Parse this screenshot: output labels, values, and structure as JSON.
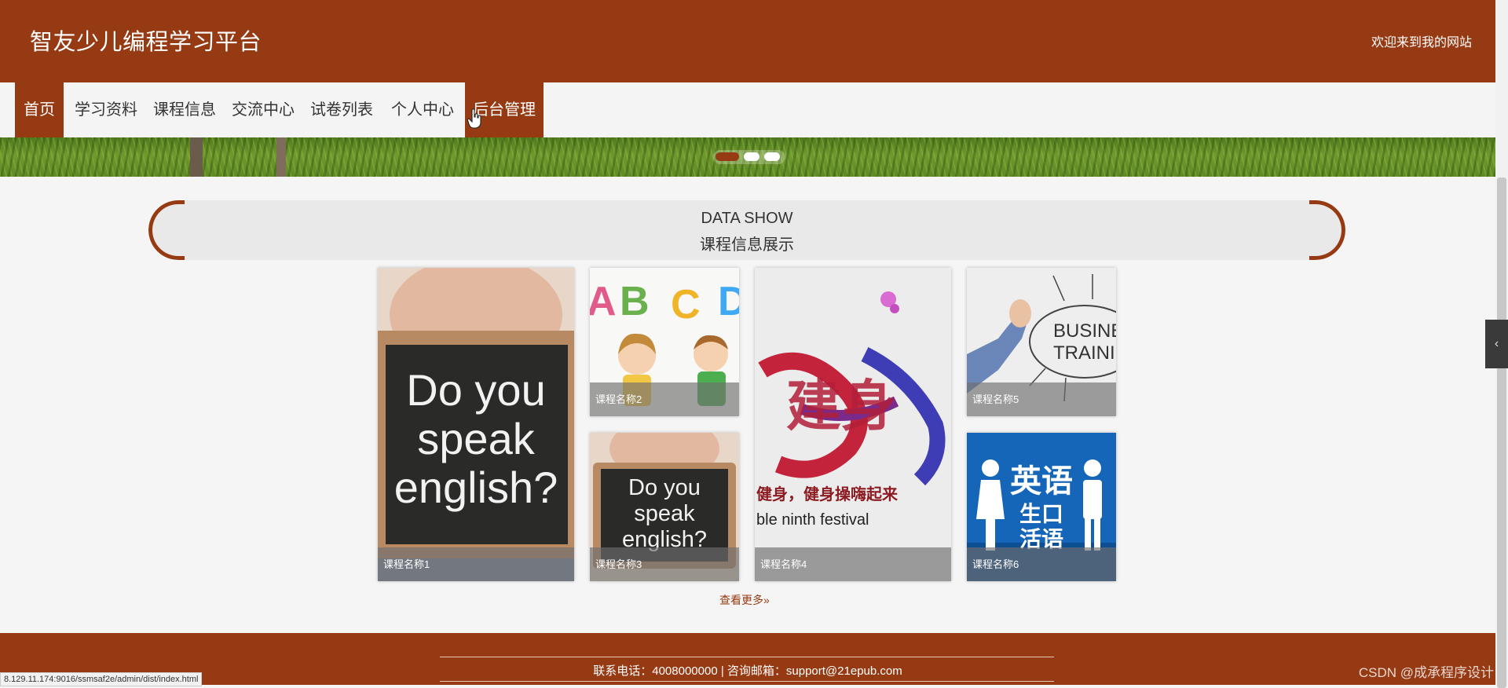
{
  "header": {
    "site_title": "智友少儿编程学习平台",
    "welcome_text": "欢迎来到我的网站"
  },
  "nav": {
    "items": [
      {
        "label": "首页",
        "active": true
      },
      {
        "label": "学习资料",
        "active": false
      },
      {
        "label": "课程信息",
        "active": false
      },
      {
        "label": "交流中心",
        "active": false
      },
      {
        "label": "试卷列表",
        "active": false
      },
      {
        "label": "个人中心",
        "active": false
      },
      {
        "label": "后台管理",
        "active": true
      }
    ]
  },
  "banner": {
    "slide_count": 3,
    "active_slide": 1
  },
  "section": {
    "title_en": "DATA SHOW",
    "title_cn": "课程信息展示"
  },
  "courses": [
    {
      "name": "课程名称1",
      "image_text": [
        "Do you",
        "speak",
        "english?"
      ]
    },
    {
      "name": "课程名称2",
      "image_text": [
        "A",
        "B",
        "C",
        "D"
      ]
    },
    {
      "name": "课程名称3",
      "image_text": [
        "Do you",
        "speak",
        "english?"
      ]
    },
    {
      "name": "课程名称4",
      "image_text": [
        "建身",
        "健身，健身操嗨起来",
        "ble ninth festival"
      ]
    },
    {
      "name": "课程名称5",
      "image_text": [
        "BUSINESS",
        "TRAINING"
      ]
    },
    {
      "name": "课程名称6",
      "image_text": [
        "英语",
        "生口",
        "活语"
      ]
    }
  ],
  "more_link": "查看更多",
  "footer": {
    "contact": "联系电话：4008000000 | 咨询邮箱：support@21epub.com"
  },
  "status_url": "8.129.11.174:9016/ssmsaf2e/admin/dist/index.html",
  "watermark": "CSDN @成承程序设计",
  "colors": {
    "brand": "#963a13",
    "page_bg": "#f5f5f5",
    "nav_bg": "#f4f4f4"
  }
}
